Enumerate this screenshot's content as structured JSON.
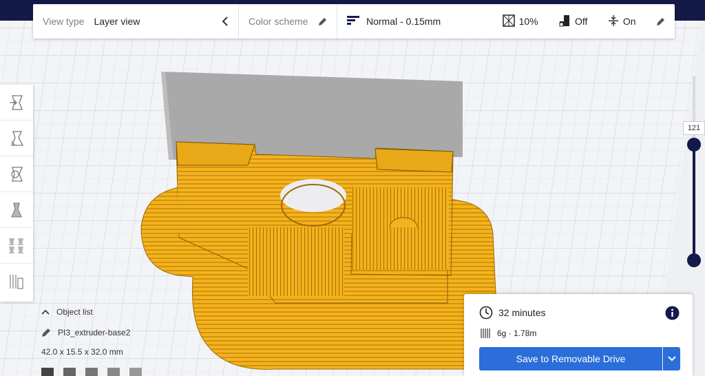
{
  "toolbar": {
    "view_type_label": "View type",
    "view_type_value": "Layer view",
    "color_scheme_label": "Color scheme",
    "profile": "Normal - 0.15mm",
    "infill": "10%",
    "support": "Off",
    "adhesion": "On"
  },
  "left_tools": [
    "move-tool-icon",
    "scale-tool-icon",
    "rotate-tool-icon",
    "mirror-tool-icon",
    "per-model-settings-icon",
    "support-blocker-icon"
  ],
  "object_list": {
    "header": "Object list",
    "name": "PI3_extruder-base2",
    "dimensions": "42.0 x 15.5 x 32.0 mm"
  },
  "layer_slider": {
    "current_layer": "121"
  },
  "print_info": {
    "time": "32 minutes",
    "material": "6g · 1.78m",
    "save_label": "Save to Removable Drive"
  },
  "colors": {
    "accent": "#2b6ed9",
    "dark": "#12194b",
    "model": "#f4b41e"
  }
}
